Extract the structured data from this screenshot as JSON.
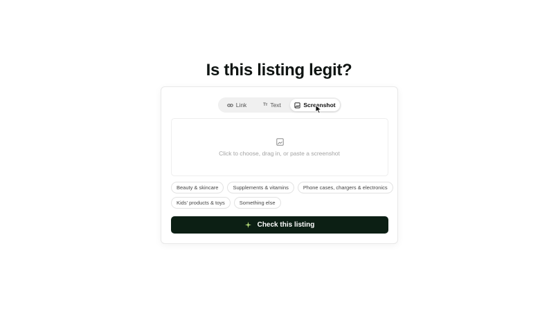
{
  "page": {
    "title": "Is this listing legit?"
  },
  "tabs": [
    {
      "label": "Link",
      "icon": "link-icon",
      "active": false
    },
    {
      "label": "Text",
      "icon": "text-icon",
      "icon_text": "Tт",
      "active": false
    },
    {
      "label": "Screenshot",
      "icon": "image-icon",
      "active": true
    }
  ],
  "dropzone": {
    "icon": "image-placeholder-icon",
    "text": "Click to choose, drag in, or paste a screenshot"
  },
  "categories": {
    "row1": [
      "Beauty & skincare",
      "Supplements & vitamins",
      "Phone cases, chargers & electronics"
    ],
    "row2": [
      "Kids' products & toys",
      "Something else"
    ]
  },
  "cta": {
    "label": "Check this listing",
    "icon": "sparkle-icon",
    "icon_color": "#b8e07a",
    "bg": "#0c1f14"
  }
}
